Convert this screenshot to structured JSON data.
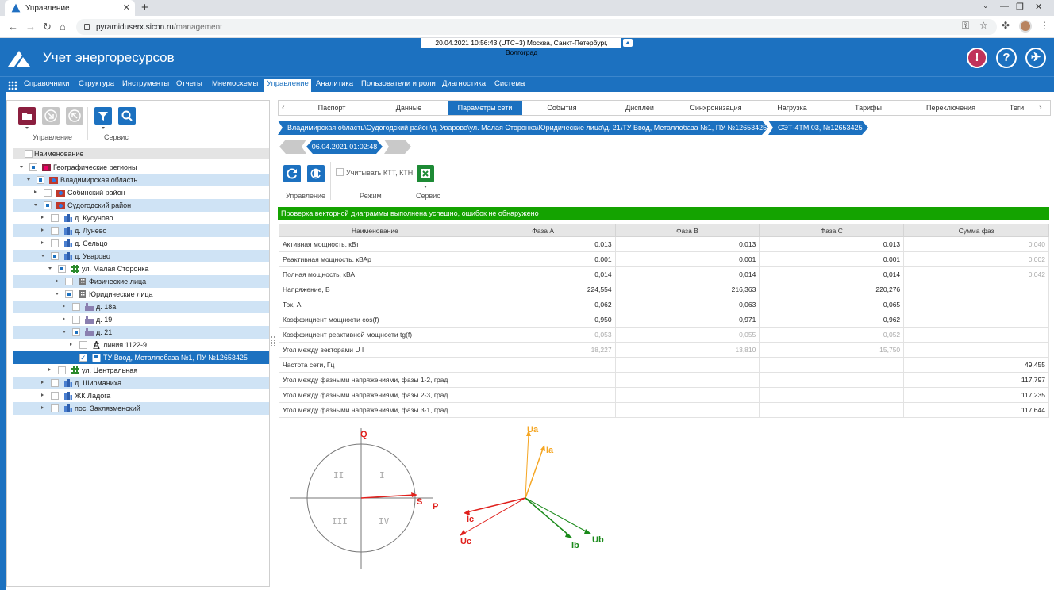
{
  "browser": {
    "tab_title": "Управление",
    "url_host": "pyramiduserx.sicon.ru",
    "url_path": "/management"
  },
  "header": {
    "datetime": "20.04.2021 10:56:43 (UTC+3) Москва, Санкт-Петербург, Волгоград",
    "title": "Учет энергоресурсов",
    "bell_icon": "!",
    "help_icon": "?",
    "user_icon": "✈"
  },
  "menu": [
    "Справочники",
    "Структура",
    "Инструменты",
    "Отчеты",
    "Мнемосхемы",
    "Управление",
    "Аналитика",
    "Пользователи и роли",
    "Диагностика",
    "Система"
  ],
  "left_toolbar": {
    "group1_label": "Управление",
    "group2_label": "Сервис"
  },
  "tree": {
    "header": "Наименование",
    "rows": [
      "Географические регионы",
      "Владимирская область",
      "Собинский район",
      "Судогодский район",
      "д. Кусуново",
      "д. Лунево",
      "д. Сельцо",
      "д. Уварово",
      "ул. Малая Сторонка",
      "Физические лица",
      "Юридические лица",
      "д. 18а",
      "д. 19",
      "д. 21",
      "линия 1122-9",
      "ТУ Ввод, Металлобаза №1, ПУ №12653425",
      "ул. Центральная",
      "д. Ширманиха",
      "ЖК Ладога",
      "пос. Заклязменский"
    ]
  },
  "tabs": [
    "Паспорт",
    "Данные",
    "Параметры сети",
    "События",
    "Дисплеи",
    "Синхронизация",
    "Нагрузка",
    "Тарифы",
    "Переключения",
    "Теги"
  ],
  "breadcrumb": {
    "path": "Владимирская область\\Судогодский район\\д. Уварово\\ул. Малая Сторонка\\Юридические лица\\д. 21\\ТУ Ввод, Металлобаза №1, ПУ №12653425",
    "device": "СЭТ-4ТМ.03, №12653425"
  },
  "date_selector": "06.04.2021 01:02:48",
  "right_toolbar": {
    "checkbox_label": "Учитывать КТТ, КТН",
    "group1_label": "Управление",
    "group2_label": "Режим",
    "group3_label": "Сервис"
  },
  "status_message": "Проверка векторной диаграммы выполнена успешно, ошибок не обнаружено",
  "params_table": {
    "headers": [
      "Наименование",
      "Фаза А",
      "Фаза B",
      "Фаза C",
      "Сумма фаз"
    ],
    "rows": [
      {
        "name": "Активная мощность, кВт",
        "a": "0,013",
        "b": "0,013",
        "c": "0,013",
        "sum": "0,040",
        "grey": false,
        "sumGrey": true
      },
      {
        "name": "Реактивная мощность, кВАр",
        "a": "0,001",
        "b": "0,001",
        "c": "0,001",
        "sum": "0,002",
        "grey": false,
        "sumGrey": true
      },
      {
        "name": "Полная мощность, кВА",
        "a": "0,014",
        "b": "0,014",
        "c": "0,014",
        "sum": "0,042",
        "grey": false,
        "sumGrey": true
      },
      {
        "name": "Напряжение, В",
        "a": "224,554",
        "b": "216,363",
        "c": "220,276",
        "sum": "",
        "grey": false,
        "sumGrey": false
      },
      {
        "name": "Ток, А",
        "a": "0,062",
        "b": "0,063",
        "c": "0,065",
        "sum": "",
        "grey": false,
        "sumGrey": false
      },
      {
        "name": "Коэффициент мощности cos(f)",
        "a": "0,950",
        "b": "0,971",
        "c": "0,962",
        "sum": "",
        "grey": false,
        "sumGrey": false
      },
      {
        "name": "Коэффициент реактивной мощности tg(f)",
        "a": "0,053",
        "b": "0,055",
        "c": "0,052",
        "sum": "",
        "grey": true,
        "sumGrey": false
      },
      {
        "name": "Угол между векторами U I",
        "a": "18,227",
        "b": "13,810",
        "c": "15,750",
        "sum": "",
        "grey": true,
        "sumGrey": false
      },
      {
        "name": "Частота сети, Гц",
        "a": "",
        "b": "",
        "c": "",
        "sum": "49,455",
        "grey": false,
        "sumGrey": false
      },
      {
        "name": "Угол между фазными напряжениями, фазы 1-2, град",
        "a": "",
        "b": "",
        "c": "",
        "sum": "117,797",
        "grey": false,
        "sumGrey": false
      },
      {
        "name": "Угол между фазными напряжениями, фазы 2-3, град",
        "a": "",
        "b": "",
        "c": "",
        "sum": "117,235",
        "grey": false,
        "sumGrey": false
      },
      {
        "name": "Угол между фазными напряжениями, фазы 3-1, град",
        "a": "",
        "b": "",
        "c": "",
        "sum": "117,644",
        "grey": false,
        "sumGrey": false
      }
    ]
  },
  "power_diagram": {
    "axis_q": "Q",
    "axis_p": "P",
    "vector_s": "S",
    "quadrants": [
      "I",
      "II",
      "III",
      "IV"
    ]
  },
  "vector_diagram": {
    "labels": {
      "ua": "Ua",
      "ia": "Ia",
      "ub": "Ub",
      "ib": "Ib",
      "uc": "Uc",
      "ic": "Ic"
    }
  },
  "colors": {
    "brand": "#1c71c0",
    "success": "#14a300",
    "phase_a": "#f5a623",
    "phase_b": "#1a8a1a",
    "phase_c": "#e0201c"
  }
}
